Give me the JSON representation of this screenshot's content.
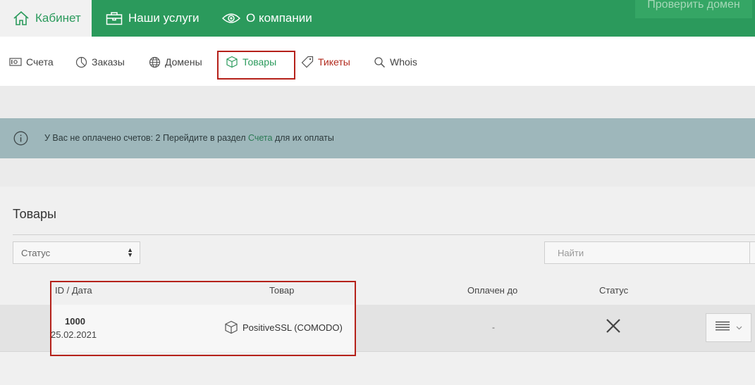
{
  "topnav": {
    "items": [
      {
        "label": "Кабинет",
        "icon": "home-icon",
        "active": true
      },
      {
        "label": "Наши услуги",
        "icon": "briefcase-icon"
      },
      {
        "label": "О компании",
        "icon": "eye-icon"
      }
    ],
    "check_domain": "Проверить домен"
  },
  "subnav": {
    "items": [
      {
        "label": "Счета",
        "icon": "money-icon"
      },
      {
        "label": "Заказы",
        "icon": "pie-chart-icon"
      },
      {
        "label": "Домены",
        "icon": "globe-icon"
      },
      {
        "label": "Товары",
        "icon": "box-icon",
        "active": true
      },
      {
        "label": "Тикеты",
        "icon": "tag-icon"
      },
      {
        "label": "Whois",
        "icon": "search-icon"
      }
    ]
  },
  "alert": {
    "text_before": "У Вас не оплачено счетов: 2 Перейдите в раздел ",
    "link": "Счета",
    "text_after": " для их оплаты",
    "icon": "info-icon"
  },
  "content": {
    "title": "Товары",
    "status_select": "Статус",
    "search_placeholder": "Найти",
    "table": {
      "headers": {
        "id_date": "ID / Дата",
        "product": "Товар",
        "paid_until": "Оплачен до",
        "status": "Статус"
      },
      "rows": [
        {
          "id": "1000",
          "date": "25.02.2021",
          "product": "PositiveSSL (COMODO)",
          "paid_until": "-",
          "status_icon": "close-icon"
        }
      ]
    }
  },
  "colors": {
    "brand_green": "#2b9a5c",
    "highlight_red": "#b5211a",
    "ticket_red": "#b22a1d"
  }
}
